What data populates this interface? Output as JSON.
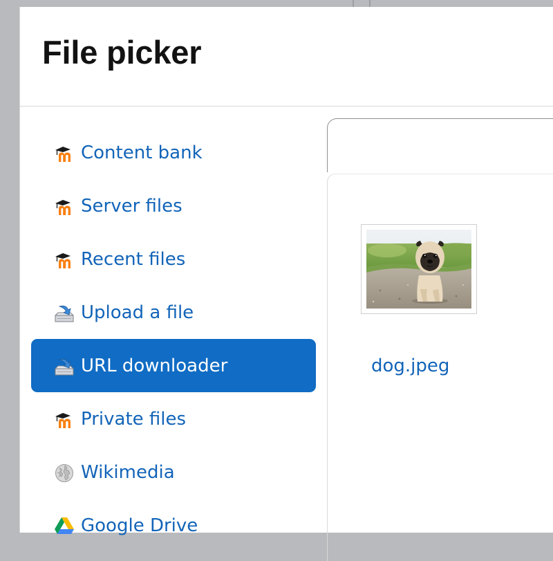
{
  "dialog": {
    "title": "File picker"
  },
  "repositories": [
    {
      "label": "Content bank",
      "icon": "moodle-icon",
      "active": false
    },
    {
      "label": "Server files",
      "icon": "moodle-icon",
      "active": false
    },
    {
      "label": "Recent files",
      "icon": "moodle-icon",
      "active": false
    },
    {
      "label": "Upload a file",
      "icon": "upload-icon",
      "active": false
    },
    {
      "label": "URL downloader",
      "icon": "download-icon",
      "active": true
    },
    {
      "label": "Private files",
      "icon": "moodle-icon",
      "active": false
    },
    {
      "label": "Wikimedia",
      "icon": "wikimedia-icon",
      "active": false
    },
    {
      "label": "Google Drive",
      "icon": "google-drive-icon",
      "active": false
    }
  ],
  "files": [
    {
      "name": "dog.jpeg",
      "thumbnail": "pug-dog-thumbnail"
    }
  ],
  "colors": {
    "link": "#1264b8",
    "active_bg": "#106cc4",
    "moodle_orange": "#f98012"
  }
}
